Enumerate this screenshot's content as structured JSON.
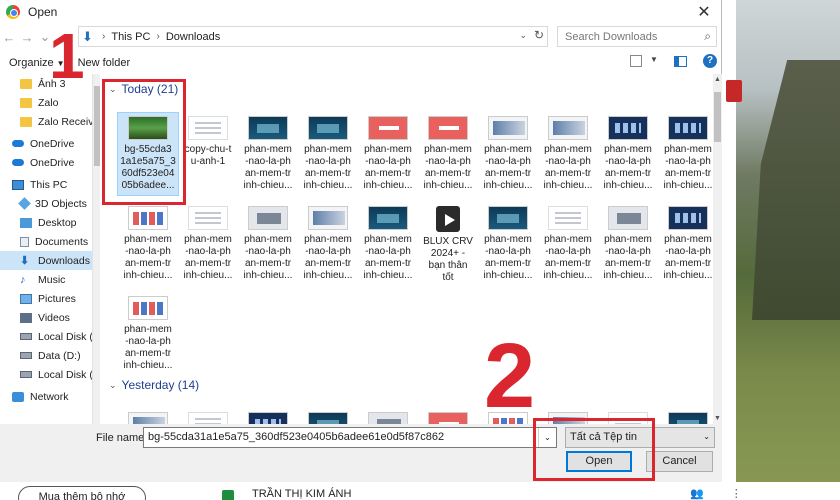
{
  "window": {
    "title": "Open",
    "close_glyph": "✕"
  },
  "nav_buttons": {
    "back": "←",
    "forward": "→",
    "recent": "⌄",
    "up": "↑"
  },
  "address": {
    "crumbs": [
      "This PC",
      "Downloads"
    ],
    "separator": "›",
    "dropdown": "⌄",
    "refresh": "↻"
  },
  "search": {
    "placeholder": "Search Downloads",
    "icon_glyph": "⌕"
  },
  "toolbar": {
    "organize": "Organize",
    "organize_arrow": "▼",
    "new_folder": "New folder",
    "view_arrow": "▼",
    "help": "?"
  },
  "nav_pane": {
    "items": [
      {
        "label": "Ảnh 3",
        "icon": "folder-icon"
      },
      {
        "label": "Zalo",
        "icon": "folder-icon"
      },
      {
        "label": "Zalo Received",
        "icon": "folder-icon"
      },
      {
        "label": "OneDrive",
        "icon": "cloud-icon"
      },
      {
        "label": "OneDrive",
        "icon": "cloud-icon"
      },
      {
        "label": "This PC",
        "icon": "computer-icon"
      },
      {
        "label": "3D Objects",
        "icon": "cube-icon"
      },
      {
        "label": "Desktop",
        "icon": "desktop-icon"
      },
      {
        "label": "Documents",
        "icon": "documents-icon"
      },
      {
        "label": "Downloads",
        "icon": "download-icon",
        "selected": true
      },
      {
        "label": "Music",
        "icon": "music-icon"
      },
      {
        "label": "Pictures",
        "icon": "pictures-icon"
      },
      {
        "label": "Videos",
        "icon": "videos-icon"
      },
      {
        "label": "Local Disk (C:)",
        "icon": "disk-icon"
      },
      {
        "label": "Data (D:)",
        "icon": "disk-icon"
      },
      {
        "label": "Local Disk (E:)",
        "icon": "disk-icon"
      },
      {
        "label": "Network",
        "icon": "network-icon"
      }
    ]
  },
  "groups": {
    "today": {
      "label": "Today (21)",
      "chevron": "⌄"
    },
    "yesterday": {
      "label": "Yesterday (14)",
      "chevron": "⌄"
    }
  },
  "files": [
    {
      "name": "bg-55cda31a1e5a75_360df523e0405b6adee...",
      "thumb": "green",
      "selected": true
    },
    {
      "name": "copy-chu-tu-anh-1",
      "thumb": "white"
    },
    {
      "name": "phan-mem-nao-la-phan-mem-trinh-chieu...",
      "thumb": "dark"
    },
    {
      "name": "phan-mem-nao-la-phan-mem-trinh-chieu...",
      "thumb": "dark"
    },
    {
      "name": "phan-mem-nao-la-phan-mem-trinh-chieu...",
      "thumb": "red"
    },
    {
      "name": "phan-mem-nao-la-phan-mem-trinh-chieu...",
      "thumb": "red"
    },
    {
      "name": "phan-mem-nao-la-phan-mem-trinh-chieu...",
      "thumb": "shot"
    },
    {
      "name": "phan-mem-nao-la-phan-mem-trinh-chieu...",
      "thumb": "shot"
    },
    {
      "name": "phan-mem-nao-la-phan-mem-trinh-chieu...",
      "thumb": "navy"
    },
    {
      "name": "phan-mem-nao-la-phan-mem-trinh-chieu...",
      "thumb": "navy"
    },
    {
      "name": "phan-mem-nao-la-phan-mem-trinh-chieu...",
      "thumb": "multi"
    },
    {
      "name": "phan-mem-nao-la-phan-mem-trinh-chieu...",
      "thumb": "white"
    },
    {
      "name": "phan-mem-nao-la-phan-mem-trinh-chieu...",
      "thumb": "gray"
    },
    {
      "name": "phan-mem-nao-la-phan-mem-trinh-chieu...",
      "thumb": "shot"
    },
    {
      "name": "phan-mem-nao-la-phan-mem-trinh-chieu...",
      "thumb": "dark"
    },
    {
      "name": "BLUX CRV 2024+ - bạn thân tốt",
      "thumb": "play"
    },
    {
      "name": "phan-mem-nao-la-phan-mem-trinh-chieu...",
      "thumb": "dark"
    },
    {
      "name": "phan-mem-nao-la-phan-mem-trinh-chieu...",
      "thumb": "white"
    },
    {
      "name": "phan-mem-nao-la-phan-mem-trinh-chieu...",
      "thumb": "gray"
    },
    {
      "name": "phan-mem-nao-la-phan-mem-trinh-chieu...",
      "thumb": "navy"
    },
    {
      "name": "phan-mem-nao-la-phan-mem-trinh-chieu...",
      "thumb": "multi"
    }
  ],
  "file_lines": [
    [
      "bg-55cda3",
      "1a1e5a75_3",
      "60df523e04",
      "05b6adee..."
    ],
    [
      "copy-chu-t",
      "u-anh-1"
    ],
    [
      "phan-mem",
      "-nao-la-ph",
      "an-mem-tr",
      "inh-chieu..."
    ],
    [
      "phan-mem",
      "-nao-la-ph",
      "an-mem-tr",
      "inh-chieu..."
    ],
    [
      "phan-mem",
      "-nao-la-ph",
      "an-mem-tr",
      "inh-chieu..."
    ],
    [
      "phan-mem",
      "-nao-la-ph",
      "an-mem-tr",
      "inh-chieu..."
    ],
    [
      "phan-mem",
      "-nao-la-ph",
      "an-mem-tr",
      "inh-chieu..."
    ],
    [
      "phan-mem",
      "-nao-la-ph",
      "an-mem-tr",
      "inh-chieu..."
    ],
    [
      "phan-mem",
      "-nao-la-ph",
      "an-mem-tr",
      "inh-chieu..."
    ],
    [
      "phan-mem",
      "-nao-la-ph",
      "an-mem-tr",
      "inh-chieu..."
    ],
    [
      "phan-mem",
      "-nao-la-ph",
      "an-mem-tr",
      "inh-chieu..."
    ],
    [
      "phan-mem",
      "-nao-la-ph",
      "an-mem-tr",
      "inh-chieu..."
    ],
    [
      "phan-mem",
      "-nao-la-ph",
      "an-mem-tr",
      "inh-chieu..."
    ],
    [
      "phan-mem",
      "-nao-la-ph",
      "an-mem-tr",
      "inh-chieu..."
    ],
    [
      "phan-mem",
      "-nao-la-ph",
      "an-mem-tr",
      "inh-chieu..."
    ],
    [
      "BLUX CRV",
      "2024+ -",
      "bạn thân",
      "tốt"
    ],
    [
      "phan-mem",
      "-nao-la-ph",
      "an-mem-tr",
      "inh-chieu..."
    ],
    [
      "phan-mem",
      "-nao-la-ph",
      "an-mem-tr",
      "inh-chieu..."
    ],
    [
      "phan-mem",
      "-nao-la-ph",
      "an-mem-tr",
      "inh-chieu..."
    ],
    [
      "phan-mem",
      "-nao-la-ph",
      "an-mem-tr",
      "inh-chieu..."
    ],
    [
      "phan-mem",
      "-nao-la-ph",
      "an-mem-tr",
      "inh-chieu..."
    ]
  ],
  "bottom": {
    "file_name_label": "File name:",
    "file_name_value": "bg-55cda31a1e5a75_360df523e0405b6adee61e0d5f87c862",
    "file_name_dropdown": "⌄",
    "file_type": "Tất cả Tệp tin",
    "file_type_dropdown": "⌄",
    "open_label": "Open",
    "cancel_label": "Cancel"
  },
  "annotations": {
    "step1": "1",
    "step2": "2",
    "color": "#d9262f"
  },
  "browser_strip": {
    "more_button": "Mua thêm bộ nhớ",
    "sheet_name": "TRẦN THỊ KIM ÁNH",
    "trailing_icons": "👥 ⋮"
  }
}
